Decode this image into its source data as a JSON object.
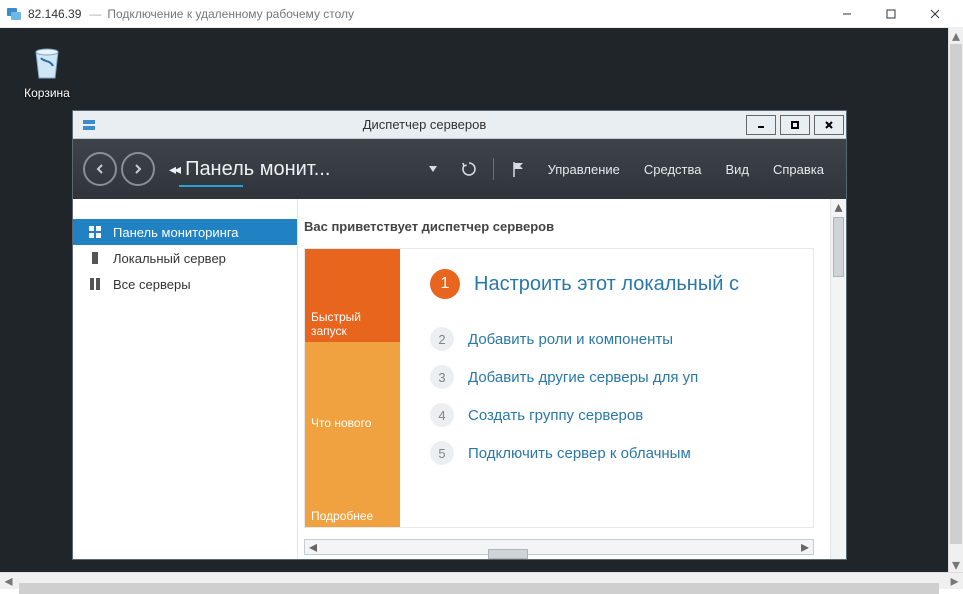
{
  "rdp": {
    "ip": "82.146.39",
    "separator": "—",
    "caption": "Подключение к удаленному рабочему столу"
  },
  "desktop": {
    "recycle_bin_label": "Корзина"
  },
  "server_manager": {
    "title": "Диспетчер серверов",
    "breadcrumb": "Панель монит...",
    "menu": {
      "manage": "Управление",
      "tools": "Средства",
      "view": "Вид",
      "help": "Справка"
    },
    "sidebar": [
      {
        "label": "Панель мониторинга"
      },
      {
        "label": "Локальный сервер"
      },
      {
        "label": "Все серверы"
      }
    ],
    "welcome": "Вас приветствует диспетчер серверов",
    "tiles": {
      "quick_start": "Быстрый запуск",
      "whats_new": "Что нового",
      "learn_more": "Подробнее"
    },
    "steps": [
      {
        "num": "1",
        "label": "Настроить этот локальный с"
      },
      {
        "num": "2",
        "label": "Добавить роли и компоненты"
      },
      {
        "num": "3",
        "label": "Добавить другие серверы для уп"
      },
      {
        "num": "4",
        "label": "Создать группу серверов"
      },
      {
        "num": "5",
        "label": "Подключить сервер к облачным"
      }
    ]
  }
}
